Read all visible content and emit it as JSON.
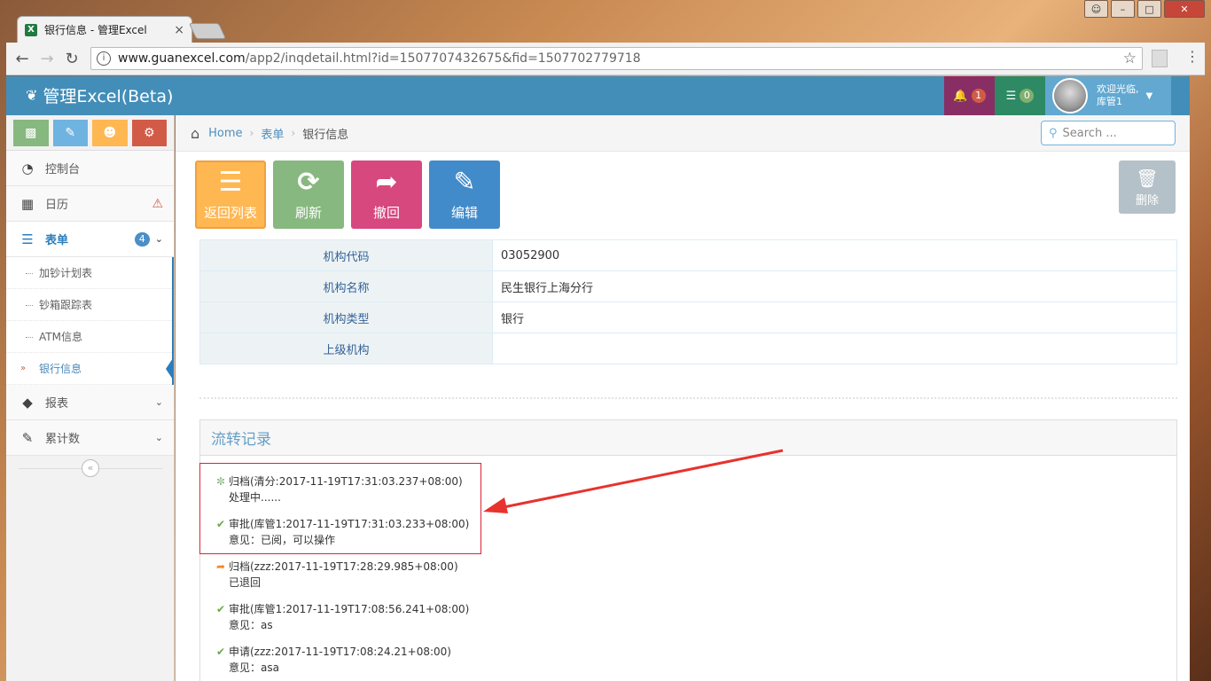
{
  "browser": {
    "tab_title": "银行信息 - 管理Excel",
    "tab_close": "×",
    "url_host": "www.guanexcel.com",
    "url_path": "/app2/inqdetail.html?id=1507707432675&fid=1507702779718"
  },
  "header": {
    "brand": "管理Excel(Beta)",
    "notifications_count": "1",
    "tasks_count": "0",
    "user_greeting": "欢迎光临,",
    "user_name": "库管1"
  },
  "sidebar": {
    "items": [
      {
        "label": "控制台",
        "icon": "dashboard-icon"
      },
      {
        "label": "日历",
        "icon": "calendar-icon",
        "alert": "warning-icon"
      },
      {
        "label": "表单",
        "icon": "list-icon",
        "badge": "4",
        "active": true
      },
      {
        "label": "报表",
        "icon": "tag-icon"
      },
      {
        "label": "累计数",
        "icon": "edit-icon"
      }
    ],
    "subitems": [
      "加钞计划表",
      "钞箱跟踪表",
      "ATM信息",
      "银行信息"
    ]
  },
  "breadcrumb": {
    "home": "Home",
    "level1": "表单",
    "current": "银行信息"
  },
  "search": {
    "placeholder": "Search ..."
  },
  "actions": {
    "back": "返回列表",
    "refresh": "刷新",
    "withdraw": "撤回",
    "edit": "编辑",
    "delete": "删除"
  },
  "details": [
    {
      "key": "机构代码",
      "value": "03052900"
    },
    {
      "key": "机构名称",
      "value": "民生银行上海分行"
    },
    {
      "key": "机构类型",
      "value": "银行"
    },
    {
      "key": "上级机构",
      "value": ""
    }
  ],
  "flow": {
    "title": "流转记录",
    "records": [
      {
        "icon": "spinner-icon",
        "head": "归档(清分:2017-11-19T17:31:03.237+08:00)",
        "note": "处理中......"
      },
      {
        "icon": "check-icon",
        "head": "审批(库管1:2017-11-19T17:31:03.233+08:00)",
        "note": "意见：已阅，可以操作"
      },
      {
        "icon": "reply-icon",
        "head": "归档(zzz:2017-11-19T17:28:29.985+08:00)",
        "note": "已退回"
      },
      {
        "icon": "check-icon",
        "head": "审批(库管1:2017-11-19T17:08:56.241+08:00)",
        "note": "意见：as"
      },
      {
        "icon": "check-icon",
        "head": "申请(zzz:2017-11-19T17:08:24.21+08:00)",
        "note": "意见：asa"
      }
    ]
  }
}
